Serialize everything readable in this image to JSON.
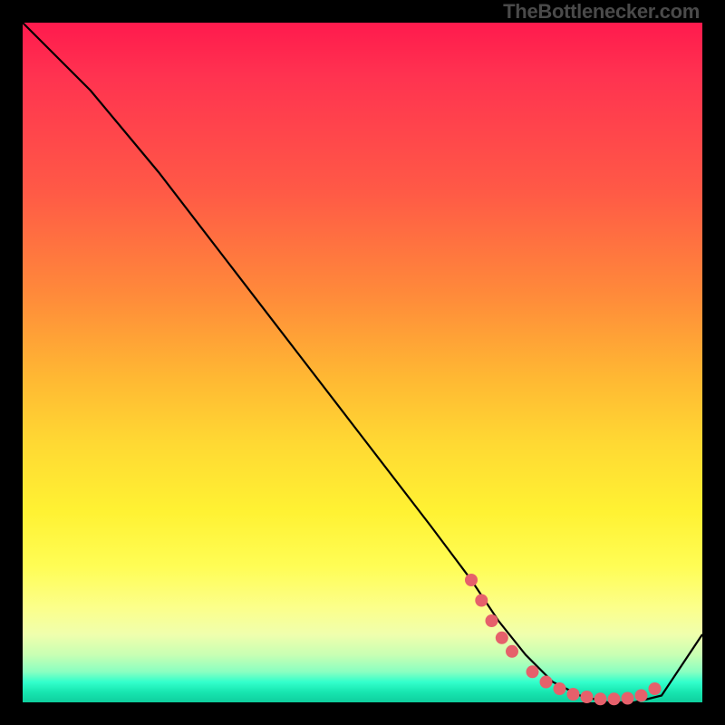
{
  "watermark": "TheBottlenecker.com",
  "chart_data": {
    "type": "line",
    "title": "",
    "xlabel": "",
    "ylabel": "",
    "xlim": [
      0,
      100
    ],
    "ylim": [
      0,
      100
    ],
    "series": [
      {
        "name": "curve",
        "x": [
          0,
          6,
          10,
          20,
          30,
          40,
          50,
          60,
          66,
          70,
          74,
          78,
          82,
          86,
          90,
          94,
          100
        ],
        "y": [
          100,
          94,
          90,
          78,
          65,
          52,
          39,
          26,
          18,
          12,
          7,
          3,
          1,
          0,
          0,
          1,
          10
        ]
      }
    ],
    "markers": [
      {
        "x": 66,
        "y": 18
      },
      {
        "x": 67.5,
        "y": 15
      },
      {
        "x": 69,
        "y": 12
      },
      {
        "x": 70.5,
        "y": 9.5
      },
      {
        "x": 72,
        "y": 7.5
      },
      {
        "x": 75,
        "y": 4.5
      },
      {
        "x": 77,
        "y": 3
      },
      {
        "x": 79,
        "y": 2
      },
      {
        "x": 81,
        "y": 1.2
      },
      {
        "x": 83,
        "y": 0.8
      },
      {
        "x": 85,
        "y": 0.5
      },
      {
        "x": 87,
        "y": 0.5
      },
      {
        "x": 89,
        "y": 0.6
      },
      {
        "x": 91,
        "y": 1
      },
      {
        "x": 93,
        "y": 2
      }
    ],
    "colors": {
      "curve": "#000000",
      "markers": "#e6606b"
    }
  }
}
